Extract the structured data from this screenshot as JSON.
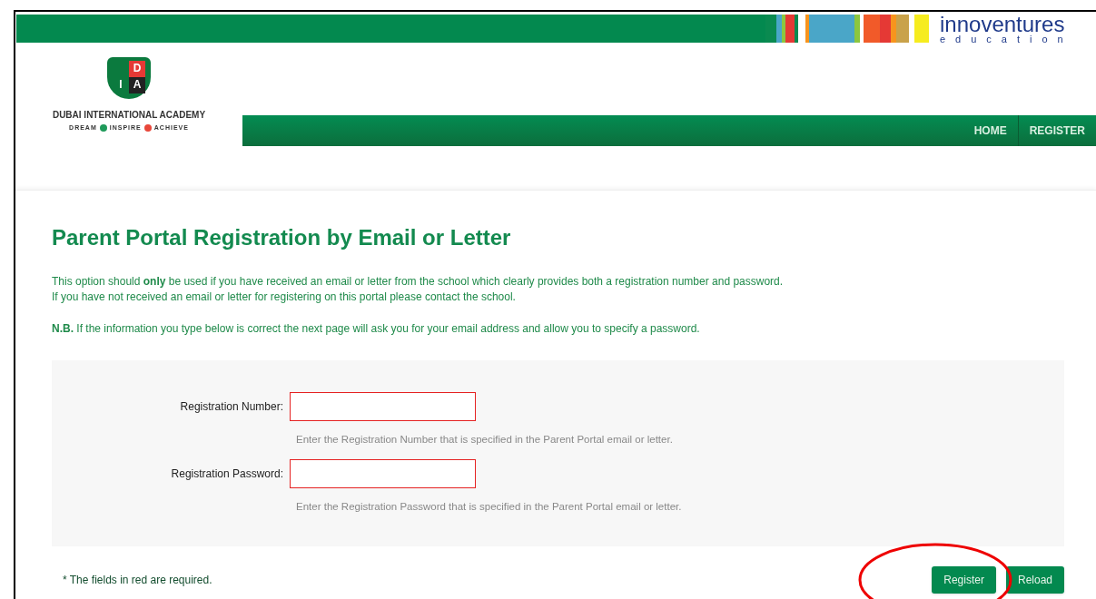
{
  "brand": {
    "name": "innoventures",
    "sub": "education"
  },
  "school": {
    "shield_letters": [
      "D",
      "I",
      "A"
    ],
    "name": "DUBAI INTERNATIONAL ACADEMY",
    "motto": [
      {
        "word": "DREAM",
        "color": "#1f9a5a"
      },
      {
        "word": "INSPIRE",
        "color": "#e8473a"
      },
      {
        "word": "ACHIEVE"
      }
    ]
  },
  "nav": [
    {
      "label": "HOME"
    },
    {
      "label": "REGISTER"
    }
  ],
  "title": "Parent Portal Registration by Email or Letter",
  "intro": [
    "This option should **only** be used if you have received an email or letter from the school which clearly provides both a registration number and password.",
    "If you have not received an email or letter for registering on this portal please contact the school."
  ],
  "note": "**N.B.** If the information you type below is correct the next page will ask you for your email address and allow you to specify a password.",
  "fields": [
    {
      "label": "Registration Number:",
      "required": true,
      "hint": "Enter the Registration Number that is specified in the Parent Portal email or letter."
    },
    {
      "label": "Registration Password:",
      "required": true,
      "hint": "Enter the Registration Password that is specified in the Parent Portal email or letter."
    }
  ],
  "required_note": "* The fields in red are required.",
  "buttons": [
    {
      "label": "Register",
      "circled": true
    },
    {
      "label": "Reload",
      "circled": false
    }
  ]
}
